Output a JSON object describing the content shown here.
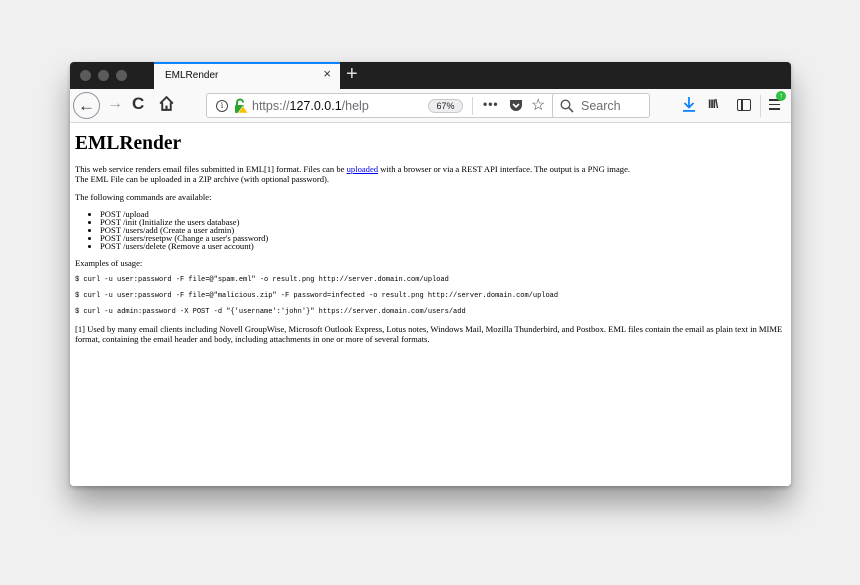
{
  "browser": {
    "tab": {
      "title": "EMLRender",
      "close_label": "×"
    },
    "new_tab_label": "+",
    "nav": {
      "back_label": "←",
      "forward_label": "→",
      "reload_label": "C"
    },
    "url": {
      "scheme": "https://",
      "host": "127.0.0.1",
      "path": "/help"
    },
    "zoom_level": "67%",
    "more_label": "•••",
    "star_label": "☆",
    "search": {
      "placeholder": "Search"
    },
    "library_label": "III\\",
    "update_badge": "↑",
    "colors": {
      "accent": "#0a84ff",
      "download": "#0a84ff",
      "update": "#30c040",
      "tabbar": "#202020"
    }
  },
  "page": {
    "title": "EMLRender",
    "intro_before_link": "This web service renders email files submitted in EML[1] format. Files can be ",
    "intro_link": "uploaded",
    "intro_after_link": " with a browser or via a REST API interface. The output is a PNG image.",
    "intro_line2": "The EML File can be uploaded in a ZIP archive (with optional password).",
    "commands_heading": "The following commands are available:",
    "commands": [
      "POST /upload",
      "POST /init (Initialize the users database)",
      "POST /users/add (Create a user admin)",
      "POST /users/resetpw (Change a user's password)",
      "POST /users/delete (Remove a user account)"
    ],
    "examples_heading": "Examples of usage:",
    "examples": [
      "$ curl -u user:password -F file=@\"spam.eml\" -o result.png http://server.domain.com/upload",
      "$ curl -u user:password -F file=@\"malicious.zip\" -F password=infected -o result.png http://server.domain.com/upload",
      "$ curl -u admin:password -X POST -d \"{'username':'john'}\" https://server.domain.com/users/add"
    ],
    "footnote": "[1] Used by many email clients including Novell GroupWise, Microsoft Outlook Express, Lotus notes, Windows Mail, Mozilla Thunderbird, and Postbox. EML files contain the email as plain text in MIME format, containing the email header and body, including attachments in one or more of several formats."
  }
}
